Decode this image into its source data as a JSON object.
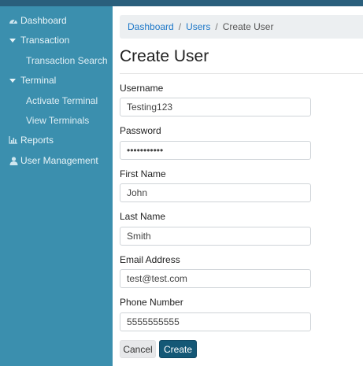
{
  "sidebar": {
    "items": [
      {
        "label": "Dashboard",
        "icon": "dashboard-icon"
      },
      {
        "label": "Transaction",
        "icon": "chevron-down-icon"
      },
      {
        "label": "Transaction Search"
      },
      {
        "label": "Terminal",
        "icon": "chevron-down-icon"
      },
      {
        "label": "Activate Terminal"
      },
      {
        "label": "View Terminals"
      },
      {
        "label": "Reports",
        "icon": "bar-chart-icon"
      },
      {
        "label": "User Management",
        "icon": "user-icon"
      }
    ]
  },
  "breadcrumb": {
    "dashboard": "Dashboard",
    "users": "Users",
    "current": "Create User",
    "separator": "/"
  },
  "page": {
    "title": "Create User"
  },
  "form": {
    "username": {
      "label": "Username",
      "value": "Testing123"
    },
    "password": {
      "label": "Password",
      "value": "•••••••••••"
    },
    "first_name": {
      "label": "First Name",
      "value": "John"
    },
    "last_name": {
      "label": "Last Name",
      "value": "Smith"
    },
    "email": {
      "label": "Email Address",
      "value": "test@test.com"
    },
    "phone": {
      "label": "Phone Number",
      "value": "5555555555"
    }
  },
  "actions": {
    "cancel_label": "Cancel",
    "create_label": "Create"
  },
  "colors": {
    "sidebar_bg": "#3b8fae",
    "topbar_bg": "#2a5f7c",
    "primary_button": "#145876",
    "link": "#1e78c8"
  }
}
